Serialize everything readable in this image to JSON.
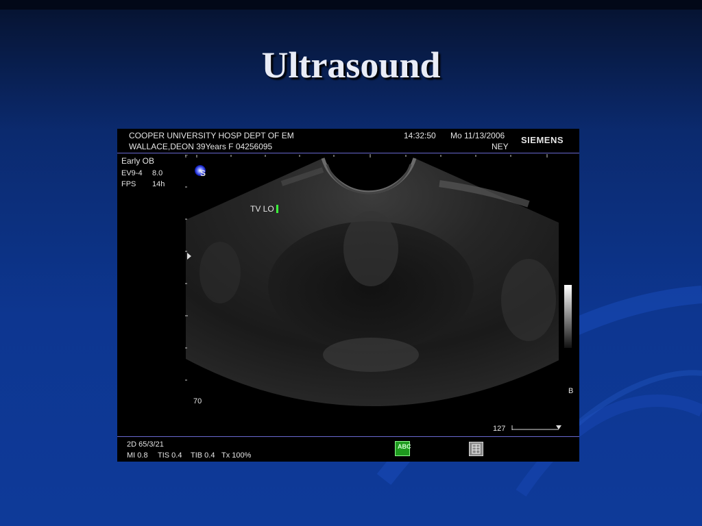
{
  "slide": {
    "title": "Ultrasound"
  },
  "ultrasound": {
    "header": {
      "institution": "COOPER UNIVERSITY HOSP DEPT OF EM",
      "patient": "WALLACE,DEON 39Years F 04256095",
      "time": "14:32:50",
      "date": "Mo 11/13/2006",
      "operator": "NEY",
      "brand": "SIEMENS"
    },
    "params": {
      "preset": "Early OB",
      "probe_label": "EV9-4",
      "probe_value": "8.0",
      "fps_label": "FPS",
      "fps_value": "14h"
    },
    "image": {
      "annotation": "TV LO",
      "orientation_marker": "S",
      "depth_label": "70",
      "grey_scale_label": "B",
      "scale_value": "127"
    },
    "footer": {
      "mode": "2D 65/3/21",
      "mi": "MI 0.8",
      "tis": "TIS 0.4",
      "tib": "TIB 0.4",
      "tx": "Tx  100%",
      "abc_icon_text": "ABC"
    },
    "colors": {
      "separator": "#6a6ad2",
      "abc_icon": "#1e9a1e",
      "probe_marker": "#3a4cff"
    }
  }
}
